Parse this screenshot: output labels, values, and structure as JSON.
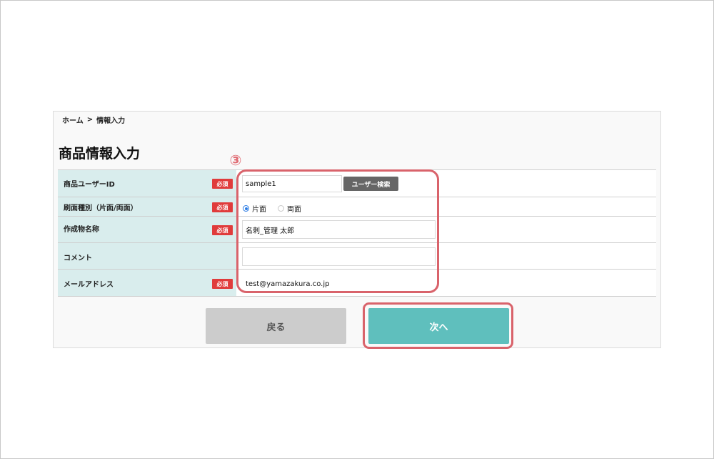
{
  "breadcrumb": {
    "home": "ホーム",
    "separator": ">",
    "current": "情報入力"
  },
  "page_title": "商品情報入力",
  "step_marker": "③",
  "required_label": "必須",
  "form": {
    "rows": [
      {
        "label": "商品ユーザーID",
        "required": true,
        "value": "sample1",
        "button": "ユーザー検索"
      },
      {
        "label": "刷面種別（片面/両面）",
        "required": true,
        "options": [
          {
            "label": "片面",
            "checked": true
          },
          {
            "label": "両面",
            "checked": false
          }
        ]
      },
      {
        "label": "作成物名称",
        "required": true,
        "value": "名刺_管理 太郎"
      },
      {
        "label": "コメント",
        "required": false,
        "value": ""
      },
      {
        "label": "メールアドレス",
        "required": true,
        "value": "test@yamazakura.co.jp"
      }
    ]
  },
  "actions": {
    "back": "戻る",
    "next": "次へ"
  },
  "colors": {
    "label_bg": "#d9eded",
    "required": "#e03b3b",
    "highlight": "#d9636b",
    "next": "#5fbfbd",
    "back": "#cccccc"
  }
}
